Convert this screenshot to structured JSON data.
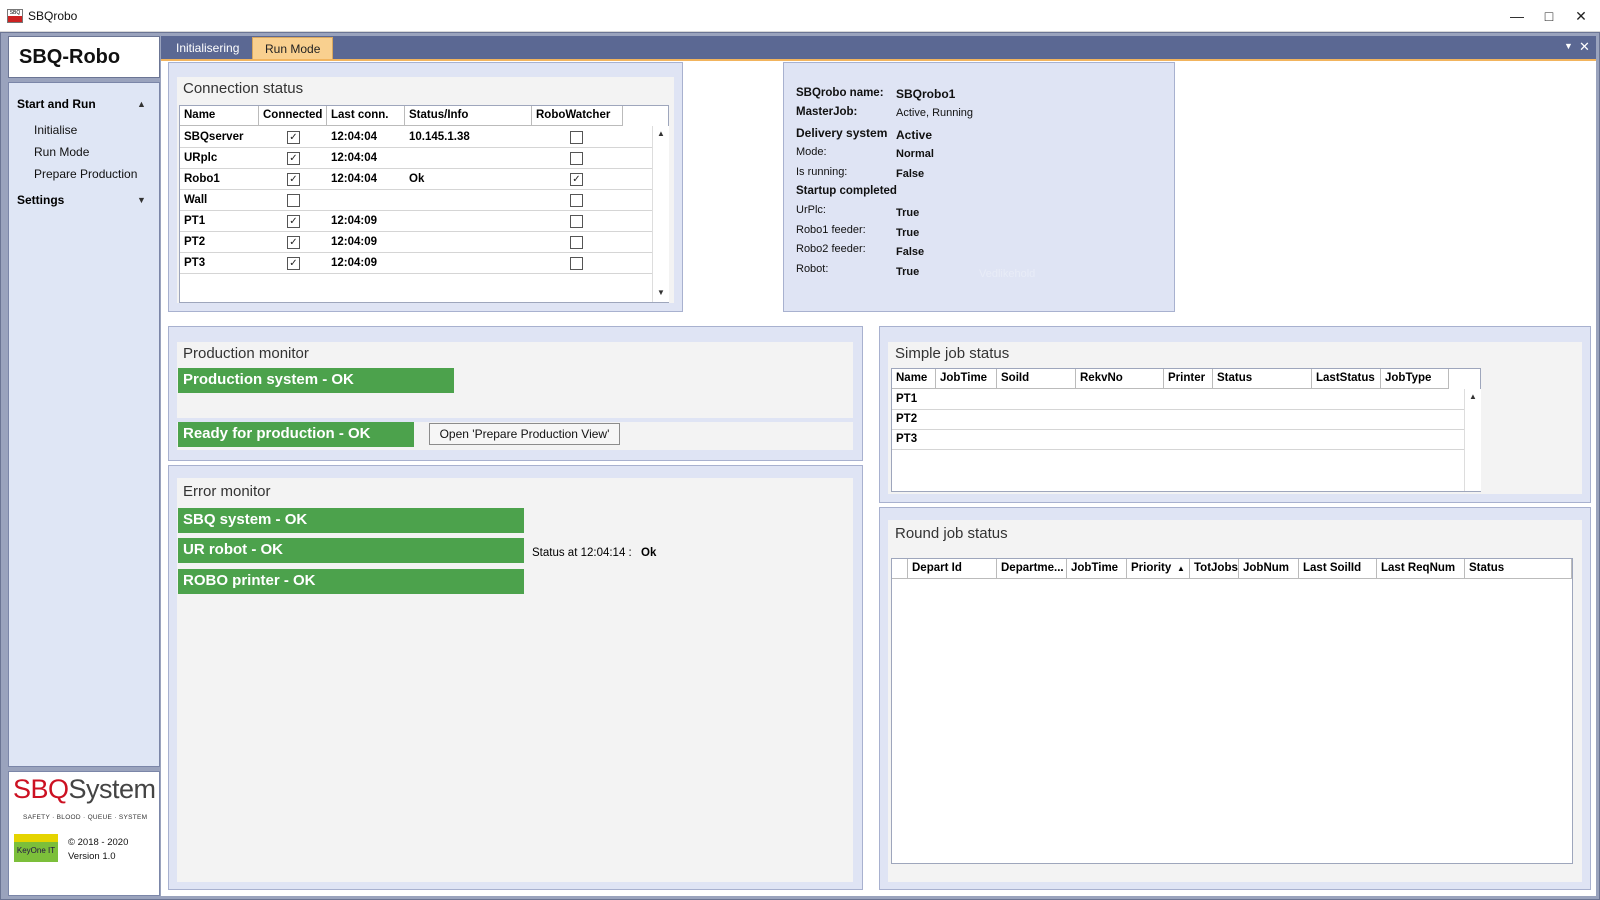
{
  "window": {
    "title": "SBQrobo",
    "icon_text": "SBQ"
  },
  "sidebar": {
    "brand": "SBQ-Robo",
    "groups": [
      {
        "label": "Start and Run",
        "expanded": true,
        "items": [
          "Initialise",
          "Run Mode",
          "Prepare Production"
        ]
      },
      {
        "label": "Settings",
        "expanded": false,
        "items": []
      }
    ],
    "logo": {
      "part1": "SBQ",
      "part2": "System",
      "tagline": "SAFETY · BLOOD · QUEUE · SYSTEM",
      "badge": "KeyOne IT",
      "copyright": "© 2018 - 2020",
      "version": "Version 1.0"
    }
  },
  "tabs": [
    {
      "label": "Initialisering",
      "active": false
    },
    {
      "label": "Run Mode",
      "active": true
    }
  ],
  "connection_status": {
    "title": "Connection status",
    "columns": [
      "Name",
      "Connected",
      "Last conn.",
      "Status/Info",
      "RoboWatcher"
    ],
    "rows": [
      {
        "name": "SBQserver",
        "connected": true,
        "last": "12:04:04",
        "info": "10.145.1.38",
        "watcher": false
      },
      {
        "name": "URplc",
        "connected": true,
        "last": "12:04:04",
        "info": "",
        "watcher": false
      },
      {
        "name": "Robo1",
        "connected": true,
        "last": "12:04:04",
        "info": "Ok",
        "watcher": true
      },
      {
        "name": "Wall",
        "connected": false,
        "last": "",
        "info": "",
        "watcher": false
      },
      {
        "name": "PT1",
        "connected": true,
        "last": "12:04:09",
        "info": "",
        "watcher": false
      },
      {
        "name": "PT2",
        "connected": true,
        "last": "12:04:09",
        "info": "",
        "watcher": false
      },
      {
        "name": "PT3",
        "connected": true,
        "last": "12:04:09",
        "info": "",
        "watcher": false
      }
    ]
  },
  "robo_info": {
    "name_label": "SBQrobo name:",
    "name_value": "SBQrobo1",
    "masterjob_label": "MasterJob:",
    "masterjob_value": "Active, Running",
    "delivery_label": "Delivery system",
    "delivery_value": "Active",
    "mode_label": "Mode:",
    "mode_value": "Normal",
    "running_label": "Is running:",
    "running_value": "False",
    "startup_label": "Startup completed",
    "urplc_label": "UrPlc:",
    "urplc_value": "True",
    "robo1_label": "Robo1 feeder:",
    "robo1_value": "True",
    "robo2_label": "Robo2 feeder:",
    "robo2_value": "False",
    "robot_label": "Robot:",
    "robot_value": "True",
    "ghost": "Vedlikehold"
  },
  "production_monitor": {
    "title": "Production monitor",
    "system_status": "Production system - OK",
    "ready_status": "Ready for production - OK",
    "open_button": "Open 'Prepare Production View'"
  },
  "error_monitor": {
    "title": "Error monitor",
    "sbq": "SBQ system - OK",
    "ur": "UR robot - OK",
    "printer": "ROBO printer - OK",
    "status_label": "Status at 12:04:14 :",
    "status_value": "Ok"
  },
  "simple_job_status": {
    "title": "Simple job status",
    "columns": [
      "Name",
      "JobTime",
      "SoiId",
      "RekvNo",
      "Printer",
      "Status",
      "LastStatus",
      "JobType"
    ],
    "rows": [
      "PT1",
      "PT2",
      "PT3"
    ]
  },
  "round_job_status": {
    "title": "Round job status",
    "columns": [
      "Depart Id",
      "Departme...",
      "JobTime",
      "Priority",
      "TotJobs",
      "JobNum",
      "Last SoilId",
      "Last ReqNum",
      "Status"
    ]
  },
  "colors": {
    "ok_green": "#4ca24c",
    "tab_active": "#f9d08f",
    "chrome": "#5b6893"
  }
}
